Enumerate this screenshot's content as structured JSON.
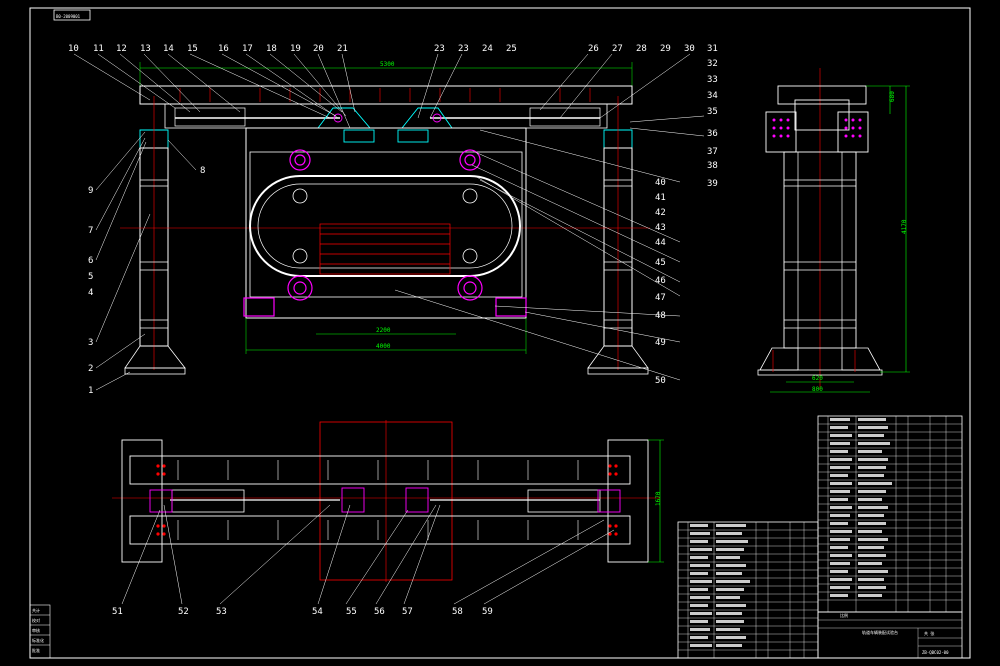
{
  "title_stamp": "B0-2009001",
  "colors": {
    "frame": "#ffffff",
    "centerline": "#ff0000",
    "dimension": "#00ff00",
    "hydraulic": "#ff00ff",
    "structure": "#00ffff"
  },
  "front_view": {
    "dim_top": "5300",
    "dim_mid": "2200",
    "dim_bottom": "4000",
    "callouts_top": [
      "10",
      "11",
      "12",
      "13",
      "14",
      "15",
      "16",
      "17",
      "18",
      "19",
      "20",
      "21",
      "23",
      "23",
      "24",
      "25",
      "26",
      "27",
      "28",
      "29",
      "30"
    ],
    "callouts_right": [
      "31",
      "32",
      "33",
      "34",
      "35",
      "36",
      "37",
      "38",
      "39",
      "40",
      "41",
      "42",
      "43",
      "44",
      "45",
      "46",
      "47",
      "48",
      "49",
      "50"
    ],
    "callouts_left": [
      "9",
      "8",
      "7",
      "6",
      "5",
      "4",
      "3",
      "2",
      "1"
    ]
  },
  "side_view": {
    "dim_height": "4170",
    "dim_top": "680",
    "dim_base_inner": "620",
    "dim_base_outer": "800"
  },
  "plan_view": {
    "dim_width": "1670",
    "callouts": [
      "51",
      "52",
      "53",
      "54",
      "55",
      "56",
      "57",
      "58",
      "59"
    ]
  },
  "title_block": {
    "name": "轨道车辆装配试验台",
    "drawing_no": "ZB-QBC02-00",
    "scale_label": "比例",
    "sheet_label": "共 张"
  },
  "left_strip": [
    "共计",
    "校对",
    "审核",
    "标准化",
    "批准"
  ]
}
